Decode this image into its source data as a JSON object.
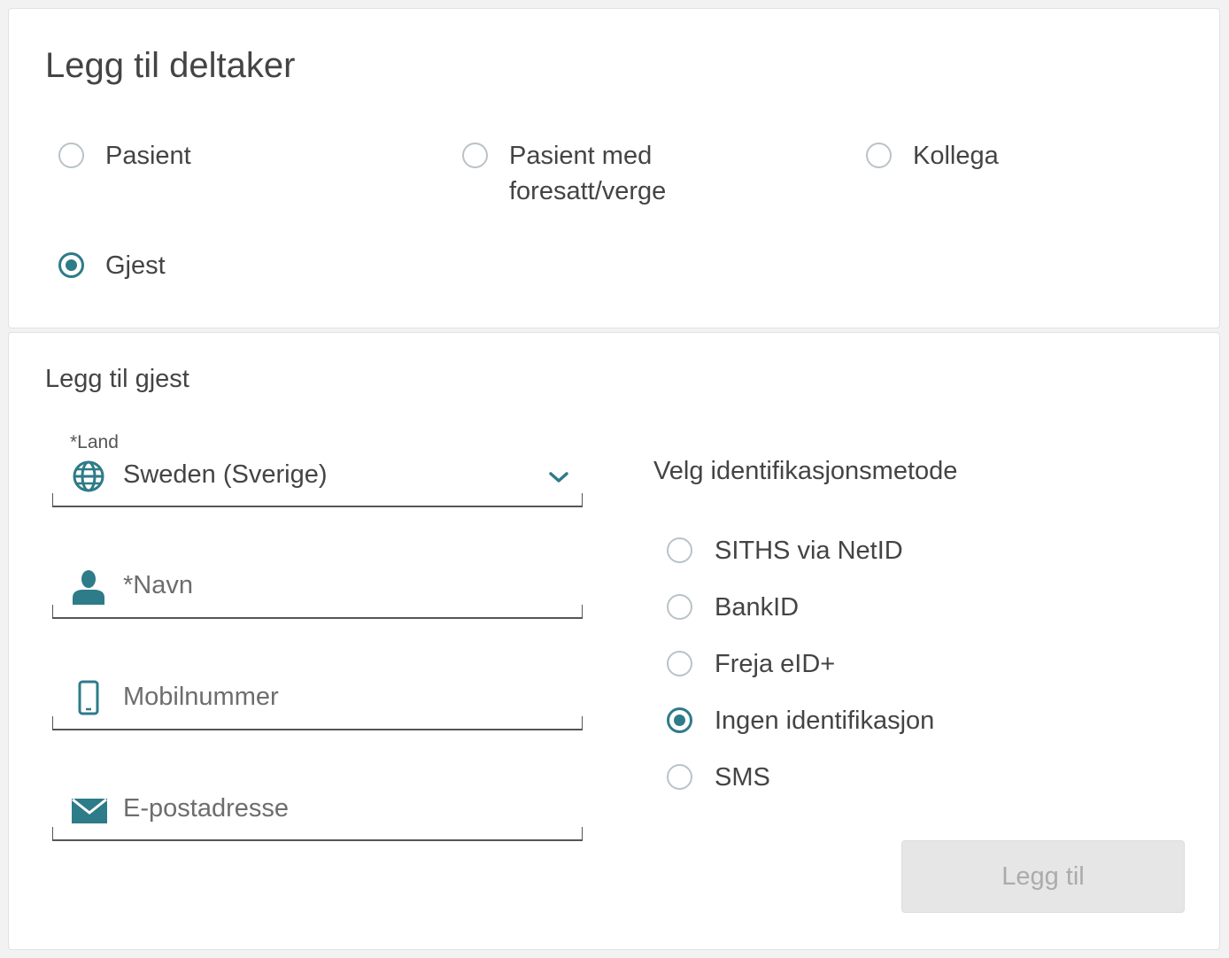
{
  "header": {
    "title": "Legg til deltaker"
  },
  "participant_types": [
    {
      "label": "Pasient",
      "selected": false
    },
    {
      "label_line1": "Pasient med",
      "label_line2": "foresatt/verge",
      "selected": false
    },
    {
      "label": "Kollega",
      "selected": false
    },
    {
      "label": "Gjest",
      "selected": true
    }
  ],
  "guest_form": {
    "title": "Legg til gjest",
    "country": {
      "label": "*Land",
      "value": "Sweden (Sverige)",
      "icon": "globe-icon"
    },
    "name": {
      "placeholder": "*Navn",
      "icon": "person-icon"
    },
    "mobile": {
      "placeholder": "Mobilnummer",
      "icon": "mobile-phone-icon"
    },
    "email": {
      "placeholder": "E-postadresse",
      "icon": "envelope-icon"
    }
  },
  "identification": {
    "title": "Velg identifikasjonsmetode",
    "options": [
      {
        "label": "SITHS via NetID",
        "selected": false
      },
      {
        "label": "BankID",
        "selected": false
      },
      {
        "label": "Freja eID+",
        "selected": false
      },
      {
        "label": "Ingen identifikasjon",
        "selected": true
      },
      {
        "label": "SMS",
        "selected": false
      }
    ]
  },
  "submit": {
    "label": "Legg til",
    "enabled": false
  },
  "colors": {
    "accent": "#2e7b89",
    "radio_border": "#b9c3c8",
    "disabled_bg": "#e6e6e6",
    "disabled_text": "#ababab"
  }
}
